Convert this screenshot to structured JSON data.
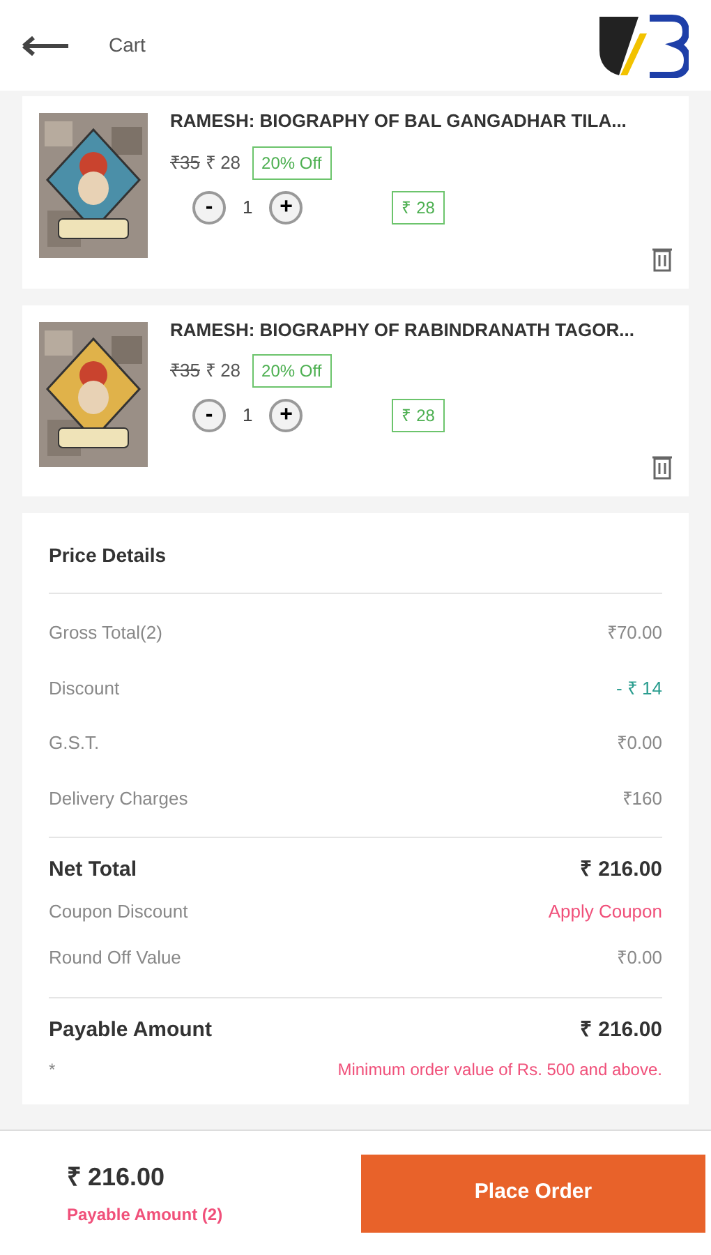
{
  "header": {
    "title": "Cart"
  },
  "items": [
    {
      "title": "RAMESH: BIOGRAPHY OF BAL GANGADHAR TILA...",
      "old_price": "₹35",
      "price": "₹ 28",
      "discount": "20% Off",
      "quantity": "1",
      "minus": "-",
      "plus": "+",
      "total": "₹ 28",
      "cover": {
        "color": "#4b8fa8"
      }
    },
    {
      "title": "RAMESH: BIOGRAPHY OF RABINDRANATH TAGOR...",
      "old_price": "₹35",
      "price": "₹ 28",
      "discount": "20% Off",
      "quantity": "1",
      "minus": "-",
      "plus": "+",
      "total": "₹ 28",
      "cover": {
        "color": "#e0b24a"
      }
    }
  ],
  "price_details": {
    "title": "Price Details",
    "sections": [
      {
        "rows": [
          {
            "kind": "plain",
            "label": "Gross Total(2)",
            "value": "₹70.00"
          },
          {
            "kind": "discount",
            "label": "Discount",
            "value": "- ₹ 14"
          },
          {
            "kind": "plain",
            "label": "G.S.T.",
            "value": "₹0.00"
          },
          {
            "kind": "plain",
            "label": "Delivery Charges",
            "value": "₹160"
          }
        ]
      },
      {
        "rows": [
          {
            "kind": "total",
            "label": "Net Total",
            "value": "₹ 216.00"
          },
          {
            "kind": "coupon",
            "label": "Coupon Discount",
            "value": "Apply Coupon"
          },
          {
            "kind": "plain",
            "label": "Round Off Value",
            "value": "₹0.00"
          }
        ]
      },
      {
        "rows": [
          {
            "kind": "total",
            "label": "Payable Amount",
            "value": "₹ 216.00"
          },
          {
            "kind": "note",
            "label": "*",
            "value": "Minimum order value of Rs. 500 and above."
          }
        ]
      }
    ]
  },
  "footer": {
    "amount": "₹ 216.00",
    "caption": "Payable Amount (2)",
    "button": "Place Order"
  }
}
